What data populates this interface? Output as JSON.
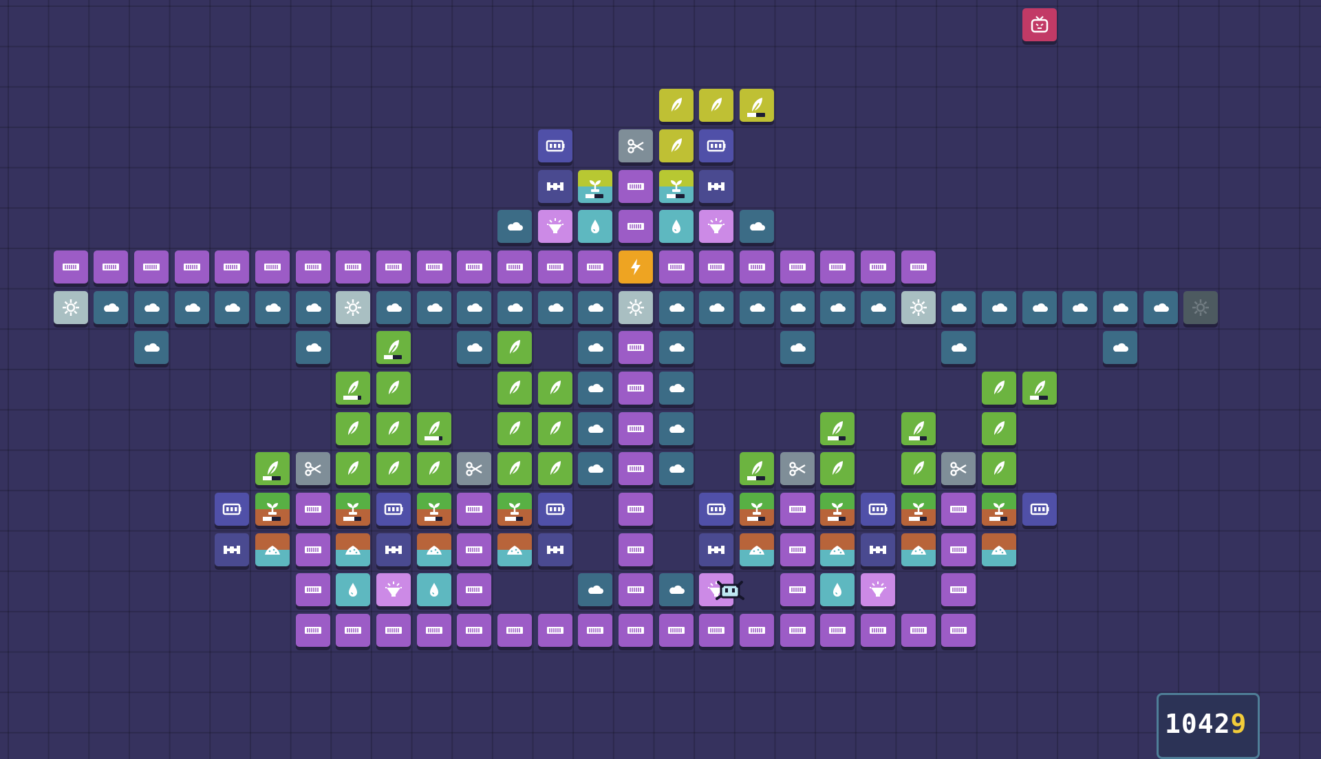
{
  "grid": {
    "tiles": [
      {
        "col": 25,
        "row": 0,
        "type": "tv"
      },
      {
        "col": 16,
        "row": 2,
        "type": "plant-y"
      },
      {
        "col": 17,
        "row": 2,
        "type": "plant-y"
      },
      {
        "col": 18,
        "row": 2,
        "type": "plant-y",
        "bar": 0.5
      },
      {
        "col": 13,
        "row": 3,
        "type": "battery"
      },
      {
        "col": 15,
        "row": 3,
        "type": "scissors"
      },
      {
        "col": 16,
        "row": 3,
        "type": "plant-y"
      },
      {
        "col": 17,
        "row": 3,
        "type": "battery"
      },
      {
        "col": 13,
        "row": 4,
        "type": "connector"
      },
      {
        "col": 14,
        "row": 4,
        "type": "sprout-b",
        "bar": 0.5
      },
      {
        "col": 15,
        "row": 4,
        "type": "pipe"
      },
      {
        "col": 16,
        "row": 4,
        "type": "sprout-b",
        "bar": 0.5
      },
      {
        "col": 17,
        "row": 4,
        "type": "connector"
      },
      {
        "col": 12,
        "row": 5,
        "type": "cloud"
      },
      {
        "col": 13,
        "row": 5,
        "type": "lamp"
      },
      {
        "col": 14,
        "row": 5,
        "type": "drop"
      },
      {
        "col": 15,
        "row": 5,
        "type": "pipe"
      },
      {
        "col": 16,
        "row": 5,
        "type": "drop"
      },
      {
        "col": 17,
        "row": 5,
        "type": "lamp"
      },
      {
        "col": 18,
        "row": 5,
        "type": "cloud"
      },
      {
        "col": 1,
        "row": 6,
        "type": "pipe"
      },
      {
        "col": 2,
        "row": 6,
        "type": "pipe"
      },
      {
        "col": 3,
        "row": 6,
        "type": "pipe"
      },
      {
        "col": 4,
        "row": 6,
        "type": "pipe"
      },
      {
        "col": 5,
        "row": 6,
        "type": "pipe"
      },
      {
        "col": 6,
        "row": 6,
        "type": "pipe"
      },
      {
        "col": 7,
        "row": 6,
        "type": "pipe"
      },
      {
        "col": 8,
        "row": 6,
        "type": "pipe"
      },
      {
        "col": 9,
        "row": 6,
        "type": "pipe"
      },
      {
        "col": 10,
        "row": 6,
        "type": "pipe"
      },
      {
        "col": 11,
        "row": 6,
        "type": "pipe"
      },
      {
        "col": 12,
        "row": 6,
        "type": "pipe"
      },
      {
        "col": 13,
        "row": 6,
        "type": "pipe"
      },
      {
        "col": 14,
        "row": 6,
        "type": "pipe"
      },
      {
        "col": 15,
        "row": 6,
        "type": "power"
      },
      {
        "col": 16,
        "row": 6,
        "type": "pipe"
      },
      {
        "col": 17,
        "row": 6,
        "type": "pipe"
      },
      {
        "col": 18,
        "row": 6,
        "type": "pipe"
      },
      {
        "col": 19,
        "row": 6,
        "type": "pipe"
      },
      {
        "col": 20,
        "row": 6,
        "type": "pipe"
      },
      {
        "col": 21,
        "row": 6,
        "type": "pipe"
      },
      {
        "col": 22,
        "row": 6,
        "type": "pipe"
      },
      {
        "col": 1,
        "row": 7,
        "type": "sun"
      },
      {
        "col": 2,
        "row": 7,
        "type": "cloud"
      },
      {
        "col": 3,
        "row": 7,
        "type": "cloud"
      },
      {
        "col": 4,
        "row": 7,
        "type": "cloud"
      },
      {
        "col": 5,
        "row": 7,
        "type": "cloud"
      },
      {
        "col": 6,
        "row": 7,
        "type": "cloud"
      },
      {
        "col": 7,
        "row": 7,
        "type": "cloud"
      },
      {
        "col": 8,
        "row": 7,
        "type": "sun"
      },
      {
        "col": 9,
        "row": 7,
        "type": "cloud"
      },
      {
        "col": 10,
        "row": 7,
        "type": "cloud"
      },
      {
        "col": 11,
        "row": 7,
        "type": "cloud"
      },
      {
        "col": 12,
        "row": 7,
        "type": "cloud"
      },
      {
        "col": 13,
        "row": 7,
        "type": "cloud"
      },
      {
        "col": 14,
        "row": 7,
        "type": "cloud"
      },
      {
        "col": 15,
        "row": 7,
        "type": "sun"
      },
      {
        "col": 16,
        "row": 7,
        "type": "cloud"
      },
      {
        "col": 17,
        "row": 7,
        "type": "cloud"
      },
      {
        "col": 18,
        "row": 7,
        "type": "cloud"
      },
      {
        "col": 19,
        "row": 7,
        "type": "cloud"
      },
      {
        "col": 20,
        "row": 7,
        "type": "cloud"
      },
      {
        "col": 21,
        "row": 7,
        "type": "cloud"
      },
      {
        "col": 22,
        "row": 7,
        "type": "sun"
      },
      {
        "col": 23,
        "row": 7,
        "type": "cloud"
      },
      {
        "col": 24,
        "row": 7,
        "type": "cloud"
      },
      {
        "col": 25,
        "row": 7,
        "type": "cloud"
      },
      {
        "col": 26,
        "row": 7,
        "type": "cloud"
      },
      {
        "col": 27,
        "row": 7,
        "type": "cloud"
      },
      {
        "col": 28,
        "row": 7,
        "type": "cloud"
      },
      {
        "col": 29,
        "row": 7,
        "type": "sun-off"
      },
      {
        "col": 3,
        "row": 8,
        "type": "cloud"
      },
      {
        "col": 7,
        "row": 8,
        "type": "cloud"
      },
      {
        "col": 9,
        "row": 8,
        "type": "plant",
        "bar": 0.5
      },
      {
        "col": 11,
        "row": 8,
        "type": "cloud"
      },
      {
        "col": 12,
        "row": 8,
        "type": "plant"
      },
      {
        "col": 14,
        "row": 8,
        "type": "cloud"
      },
      {
        "col": 15,
        "row": 8,
        "type": "pipe"
      },
      {
        "col": 16,
        "row": 8,
        "type": "cloud"
      },
      {
        "col": 19,
        "row": 8,
        "type": "cloud"
      },
      {
        "col": 23,
        "row": 8,
        "type": "cloud"
      },
      {
        "col": 27,
        "row": 8,
        "type": "cloud"
      },
      {
        "col": 8,
        "row": 9,
        "type": "plant",
        "bar": 0.8
      },
      {
        "col": 9,
        "row": 9,
        "type": "plant"
      },
      {
        "col": 12,
        "row": 9,
        "type": "plant"
      },
      {
        "col": 13,
        "row": 9,
        "type": "plant"
      },
      {
        "col": 14,
        "row": 9,
        "type": "cloud"
      },
      {
        "col": 15,
        "row": 9,
        "type": "pipe"
      },
      {
        "col": 16,
        "row": 9,
        "type": "cloud"
      },
      {
        "col": 24,
        "row": 9,
        "type": "plant"
      },
      {
        "col": 25,
        "row": 9,
        "type": "plant",
        "bar": 0.5
      },
      {
        "col": 8,
        "row": 10,
        "type": "plant"
      },
      {
        "col": 9,
        "row": 10,
        "type": "plant"
      },
      {
        "col": 10,
        "row": 10,
        "type": "plant",
        "bar": 0.8
      },
      {
        "col": 12,
        "row": 10,
        "type": "plant"
      },
      {
        "col": 13,
        "row": 10,
        "type": "plant"
      },
      {
        "col": 14,
        "row": 10,
        "type": "cloud"
      },
      {
        "col": 15,
        "row": 10,
        "type": "pipe"
      },
      {
        "col": 16,
        "row": 10,
        "type": "cloud"
      },
      {
        "col": 20,
        "row": 10,
        "type": "plant",
        "bar": 0.6
      },
      {
        "col": 22,
        "row": 10,
        "type": "plant",
        "bar": 0.6
      },
      {
        "col": 24,
        "row": 10,
        "type": "plant"
      },
      {
        "col": 6,
        "row": 11,
        "type": "plant",
        "bar": 0.5
      },
      {
        "col": 7,
        "row": 11,
        "type": "scissors"
      },
      {
        "col": 8,
        "row": 11,
        "type": "plant"
      },
      {
        "col": 9,
        "row": 11,
        "type": "plant"
      },
      {
        "col": 10,
        "row": 11,
        "type": "plant"
      },
      {
        "col": 11,
        "row": 11,
        "type": "scissors"
      },
      {
        "col": 12,
        "row": 11,
        "type": "plant"
      },
      {
        "col": 13,
        "row": 11,
        "type": "plant"
      },
      {
        "col": 14,
        "row": 11,
        "type": "cloud"
      },
      {
        "col": 15,
        "row": 11,
        "type": "pipe"
      },
      {
        "col": 16,
        "row": 11,
        "type": "cloud"
      },
      {
        "col": 18,
        "row": 11,
        "type": "plant",
        "bar": 0.5
      },
      {
        "col": 19,
        "row": 11,
        "type": "scissors"
      },
      {
        "col": 20,
        "row": 11,
        "type": "plant"
      },
      {
        "col": 22,
        "row": 11,
        "type": "plant"
      },
      {
        "col": 23,
        "row": 11,
        "type": "scissors"
      },
      {
        "col": 24,
        "row": 11,
        "type": "plant"
      },
      {
        "col": 5,
        "row": 12,
        "type": "battery"
      },
      {
        "col": 6,
        "row": 12,
        "type": "sprout",
        "bar": 0.5
      },
      {
        "col": 7,
        "row": 12,
        "type": "pipe"
      },
      {
        "col": 8,
        "row": 12,
        "type": "sprout",
        "bar": 0.6
      },
      {
        "col": 9,
        "row": 12,
        "type": "battery"
      },
      {
        "col": 10,
        "row": 12,
        "type": "sprout",
        "bar": 0.6
      },
      {
        "col": 11,
        "row": 12,
        "type": "pipe"
      },
      {
        "col": 12,
        "row": 12,
        "type": "sprout",
        "bar": 0.6
      },
      {
        "col": 13,
        "row": 12,
        "type": "battery"
      },
      {
        "col": 15,
        "row": 12,
        "type": "pipe"
      },
      {
        "col": 17,
        "row": 12,
        "type": "battery"
      },
      {
        "col": 18,
        "row": 12,
        "type": "sprout",
        "bar": 0.6
      },
      {
        "col": 19,
        "row": 12,
        "type": "pipe"
      },
      {
        "col": 20,
        "row": 12,
        "type": "sprout",
        "bar": 0.6
      },
      {
        "col": 21,
        "row": 12,
        "type": "battery"
      },
      {
        "col": 22,
        "row": 12,
        "type": "sprout",
        "bar": 0.6
      },
      {
        "col": 23,
        "row": 12,
        "type": "pipe"
      },
      {
        "col": 24,
        "row": 12,
        "type": "sprout",
        "bar": 0.6
      },
      {
        "col": 25,
        "row": 12,
        "type": "battery"
      },
      {
        "col": 5,
        "row": 13,
        "type": "connector"
      },
      {
        "col": 6,
        "row": 13,
        "type": "pile"
      },
      {
        "col": 7,
        "row": 13,
        "type": "pipe"
      },
      {
        "col": 8,
        "row": 13,
        "type": "pile"
      },
      {
        "col": 9,
        "row": 13,
        "type": "connector"
      },
      {
        "col": 10,
        "row": 13,
        "type": "pile"
      },
      {
        "col": 11,
        "row": 13,
        "type": "pipe"
      },
      {
        "col": 12,
        "row": 13,
        "type": "pile"
      },
      {
        "col": 13,
        "row": 13,
        "type": "connector"
      },
      {
        "col": 15,
        "row": 13,
        "type": "pipe"
      },
      {
        "col": 17,
        "row": 13,
        "type": "connector"
      },
      {
        "col": 18,
        "row": 13,
        "type": "pile"
      },
      {
        "col": 19,
        "row": 13,
        "type": "pipe"
      },
      {
        "col": 20,
        "row": 13,
        "type": "pile"
      },
      {
        "col": 21,
        "row": 13,
        "type": "connector"
      },
      {
        "col": 22,
        "row": 13,
        "type": "pile"
      },
      {
        "col": 23,
        "row": 13,
        "type": "pipe"
      },
      {
        "col": 24,
        "row": 13,
        "type": "pile"
      },
      {
        "col": 7,
        "row": 14,
        "type": "pipe"
      },
      {
        "col": 8,
        "row": 14,
        "type": "drop"
      },
      {
        "col": 9,
        "row": 14,
        "type": "lamp"
      },
      {
        "col": 10,
        "row": 14,
        "type": "drop"
      },
      {
        "col": 11,
        "row": 14,
        "type": "pipe"
      },
      {
        "col": 14,
        "row": 14,
        "type": "cloud"
      },
      {
        "col": 15,
        "row": 14,
        "type": "pipe"
      },
      {
        "col": 16,
        "row": 14,
        "type": "cloud"
      },
      {
        "col": 17,
        "row": 14,
        "type": "lamp"
      },
      {
        "col": 19,
        "row": 14,
        "type": "pipe"
      },
      {
        "col": 20,
        "row": 14,
        "type": "drop"
      },
      {
        "col": 21,
        "row": 14,
        "type": "lamp"
      },
      {
        "col": 23,
        "row": 14,
        "type": "pipe"
      },
      {
        "col": 7,
        "row": 15,
        "type": "pipe"
      },
      {
        "col": 8,
        "row": 15,
        "type": "pipe"
      },
      {
        "col": 9,
        "row": 15,
        "type": "pipe"
      },
      {
        "col": 10,
        "row": 15,
        "type": "pipe"
      },
      {
        "col": 11,
        "row": 15,
        "type": "pipe"
      },
      {
        "col": 12,
        "row": 15,
        "type": "pipe"
      },
      {
        "col": 13,
        "row": 15,
        "type": "pipe"
      },
      {
        "col": 14,
        "row": 15,
        "type": "pipe"
      },
      {
        "col": 15,
        "row": 15,
        "type": "pipe"
      },
      {
        "col": 16,
        "row": 15,
        "type": "pipe"
      },
      {
        "col": 17,
        "row": 15,
        "type": "pipe"
      },
      {
        "col": 18,
        "row": 15,
        "type": "pipe"
      },
      {
        "col": 19,
        "row": 15,
        "type": "pipe"
      },
      {
        "col": 20,
        "row": 15,
        "type": "pipe"
      },
      {
        "col": 21,
        "row": 15,
        "type": "pipe"
      },
      {
        "col": 22,
        "row": 15,
        "type": "pipe"
      },
      {
        "col": 23,
        "row": 15,
        "type": "pipe"
      }
    ]
  },
  "hud": {
    "score_main": "1042",
    "score_last": "9"
  },
  "colors": {
    "background": "#36325e",
    "score_accent": "#f2cc3a"
  }
}
